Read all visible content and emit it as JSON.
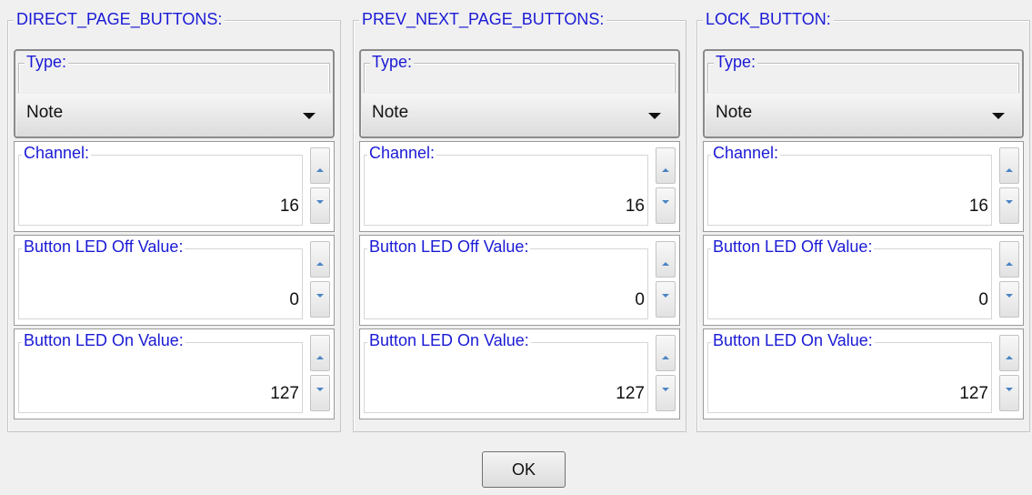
{
  "groups": [
    {
      "title": "DIRECT_PAGE_BUTTONS:",
      "type": {
        "label": "Type:",
        "value": "Note"
      },
      "spinners": [
        {
          "label": "Channel:",
          "value": "16"
        },
        {
          "label": "Button LED Off Value:",
          "value": "0"
        },
        {
          "label": "Button LED On Value:",
          "value": "127"
        }
      ]
    },
    {
      "title": "PREV_NEXT_PAGE_BUTTONS:",
      "type": {
        "label": "Type:",
        "value": "Note"
      },
      "spinners": [
        {
          "label": "Channel:",
          "value": "16"
        },
        {
          "label": "Button LED Off Value:",
          "value": "0"
        },
        {
          "label": "Button LED On Value:",
          "value": "127"
        }
      ]
    },
    {
      "title": "LOCK_BUTTON:",
      "type": {
        "label": "Type:",
        "value": "Note"
      },
      "spinners": [
        {
          "label": "Channel:",
          "value": "16"
        },
        {
          "label": "Button LED Off Value:",
          "value": "0"
        },
        {
          "label": "Button LED On Value:",
          "value": "127"
        }
      ]
    }
  ],
  "ok_label": "OK",
  "colors": {
    "label_blue": "#1a1ad6",
    "spin_arrow": "#4a84c4",
    "background": "#f0f0f0"
  }
}
